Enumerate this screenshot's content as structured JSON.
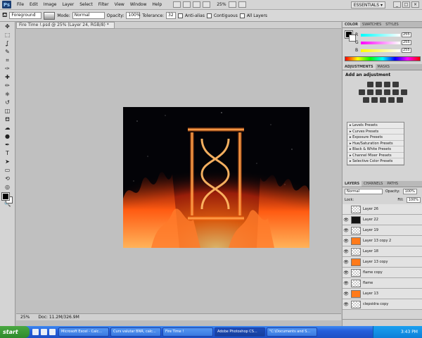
{
  "menubar": {
    "logo": "Ps",
    "items": [
      "File",
      "Edit",
      "Image",
      "Layer",
      "Select",
      "Filter",
      "View",
      "Window",
      "Help"
    ],
    "zoom": "25%",
    "workspace": "ESSENTIALS ▾",
    "window_buttons": [
      "_",
      "□",
      "×"
    ]
  },
  "options": {
    "fill_source": "Foreground",
    "mode_label": "Mode:",
    "mode_value": "Normal",
    "opacity_label": "Opacity:",
    "opacity_value": "100%",
    "tolerance_label": "Tolerance:",
    "tolerance_value": "32",
    "antialias_label": "Anti-alias",
    "contiguous_label": "Contiguous",
    "alllayers_label": "All Layers"
  },
  "document": {
    "tab_title": "Fire Time !.psd @ 25% (Layer 24, RGB/8) *",
    "status_zoom": "25%",
    "status_doc": "Doc: 11.2M/326.9M"
  },
  "color_panel": {
    "tabs": [
      "COLOR",
      "SWATCHES",
      "STYLES"
    ],
    "channels": [
      {
        "label": "R",
        "value": "255"
      },
      {
        "label": "G",
        "value": "255"
      },
      {
        "label": "B",
        "value": "255"
      }
    ]
  },
  "adjustments_panel": {
    "tabs": [
      "ADJUSTMENTS",
      "MASKS"
    ],
    "title": "Add an adjustment",
    "presets": [
      "Levels Presets",
      "Curves Presets",
      "Exposure Presets",
      "Hue/Saturation Presets",
      "Black & White Presets",
      "Channel Mixer Presets",
      "Selective Color Presets"
    ]
  },
  "layers_panel": {
    "tabs": [
      "LAYERS",
      "CHANNELS",
      "PATHS"
    ],
    "blend_mode": "Normal",
    "opacity_label": "Opacity:",
    "opacity_value": "100%",
    "lock_label": "Lock:",
    "fill_label": "Fill:",
    "fill_value": "100%",
    "layers": [
      {
        "name": "Layer 26",
        "thumb": "transparent",
        "visible": false
      },
      {
        "name": "Layer 22",
        "thumb": "dark",
        "visible": true
      },
      {
        "name": "Layer 19",
        "thumb": "transparent",
        "visible": true
      },
      {
        "name": "Layer 13 copy 2",
        "thumb": "orange",
        "visible": true
      },
      {
        "name": "Layer 18",
        "thumb": "transparent",
        "visible": true
      },
      {
        "name": "Layer 13 copy",
        "thumb": "orange",
        "visible": true
      },
      {
        "name": "flame copy",
        "thumb": "transparent",
        "visible": true
      },
      {
        "name": "flame",
        "thumb": "transparent",
        "visible": true
      },
      {
        "name": "Layer 13",
        "thumb": "orange",
        "visible": true
      },
      {
        "name": "clepsidra copy",
        "thumb": "transparent",
        "visible": true
      }
    ]
  },
  "taskbar": {
    "start_label": "start",
    "tasks": [
      {
        "label": "Microsoft Excel - Calc...",
        "active": false
      },
      {
        "label": "Curs valutar BNR, calc...",
        "active": false
      },
      {
        "label": "Fire Time !",
        "active": false
      },
      {
        "label": "Adobe Photoshop CS...",
        "active": true
      },
      {
        "label": "\"C:\\Documents and S...",
        "active": false
      }
    ],
    "clock": "3:43 PM"
  },
  "colors": {
    "accent_selected_layer": "#a8c6ee",
    "taskbar_blue": "#245edb",
    "start_green": "#3a9a33",
    "flame_orange": "#ff7a1a"
  },
  "icons": {
    "tools": [
      "move-icon",
      "marquee-icon",
      "lasso-icon",
      "quick-select-icon",
      "crop-icon",
      "eyedropper-icon",
      "healing-icon",
      "brush-icon",
      "clone-stamp-icon",
      "history-brush-icon",
      "eraser-icon",
      "paint-bucket-icon",
      "blur-icon",
      "dodge-icon",
      "pen-icon",
      "type-icon",
      "path-select-icon",
      "shape-icon",
      "3d-rotate-icon",
      "3d-orbit-icon",
      "hand-icon",
      "zoom-icon"
    ]
  }
}
